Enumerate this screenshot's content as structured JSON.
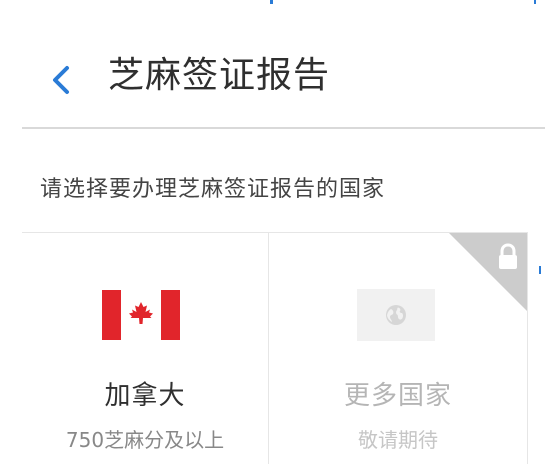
{
  "header": {
    "title": "芝麻签证报告",
    "back_icon": "chevron-left-icon"
  },
  "colors": {
    "accent": "#2a7bd6",
    "canada_red": "#e1252b",
    "corner": "#cccccc"
  },
  "subtitle": "请选择要办理芝麻签证报告的国家",
  "countries": [
    {
      "name": "加拿大",
      "note": "750芝麻分及以上",
      "icon": "canada-flag-icon"
    },
    {
      "name": "更多国家",
      "note": "敬请期待",
      "icon": "globe-icon",
      "locked_icon": "lock-icon"
    }
  ]
}
